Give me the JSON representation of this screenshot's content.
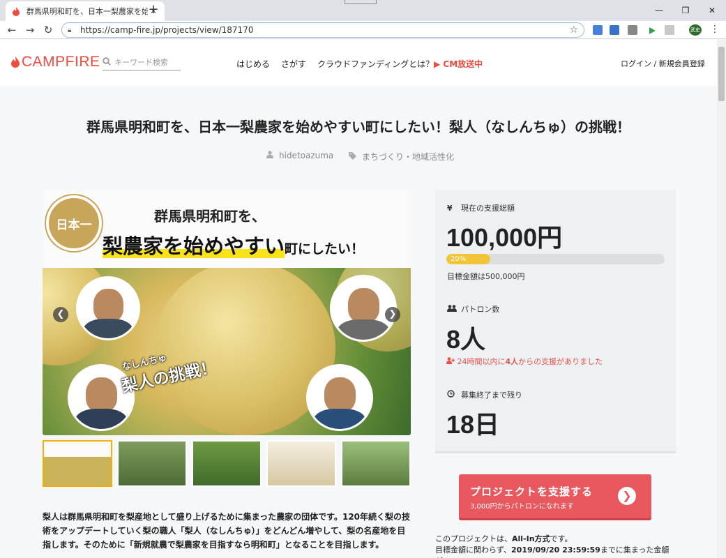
{
  "browser": {
    "tab_title": "群馬県明和町を、日本一梨農家を始",
    "url": "https://camp-fire.jp/projects/view/187170",
    "profile_label": "武史"
  },
  "header": {
    "logo": "CAMPFIRE",
    "search_placeholder": "キーワード検索",
    "nav": [
      "はじめる",
      "さがす",
      "クラウドファンディングとは？"
    ],
    "cm": "CM放送中",
    "login": "ログイン / 新規会員登録"
  },
  "project": {
    "title": "群馬県明和町を、日本一梨農家を始めやすい町にしたい！梨人（なしんちゅ）の挑戦！",
    "owner": "hidetoazuma",
    "category": "まちづくり・地域活性化"
  },
  "hero": {
    "badge": "日本一",
    "line1": "群馬県明和町を、",
    "line2_highlight": "梨農家を始めやすい",
    "line2_rest": "町にしたい！",
    "tagline_small": "なしんちゅ",
    "tagline_big": "梨人の挑戦！"
  },
  "stats": {
    "funding_label": "現在の支援総額",
    "funding_value": "100,000円",
    "progress_percent": 20,
    "progress_text": "20%",
    "goal_text": "目標金額は500,000円",
    "patron_label": "パトロン数",
    "patron_value": "8人",
    "recent_prefix": "24時間以内に",
    "recent_count": "4人",
    "recent_suffix": "からの支援がありました",
    "remaining_label": "募集終了まで残り",
    "remaining_value": "18日"
  },
  "support": {
    "button_label": "プロジェクトを支援する",
    "button_sub": "3,000円からパトロンになれます"
  },
  "allin": {
    "line1_prefix": "このプロジェクトは、",
    "line1_bold": "All-In方式",
    "line1_suffix": "です。",
    "line2_prefix": "目標金額に関わらず、",
    "line2_bold": "2019/09/20 23:59:59",
    "line2_suffix": "までに集まった金額が"
  },
  "description": "梨人は群馬県明和町を梨産地として盛り上げるために集まった農家の団体です。120年続く梨の技術をアップデートしていく梨の職人「梨人（なしんちゅ）」をどんどん増やして、梨の名産地を目指します。そのために「新規就農で梨農家を目指すなら明和町」となることを目指します。",
  "colors": {
    "brand": "#f04a3f",
    "progress": "#f3c437",
    "support_button": "#e8585e"
  }
}
